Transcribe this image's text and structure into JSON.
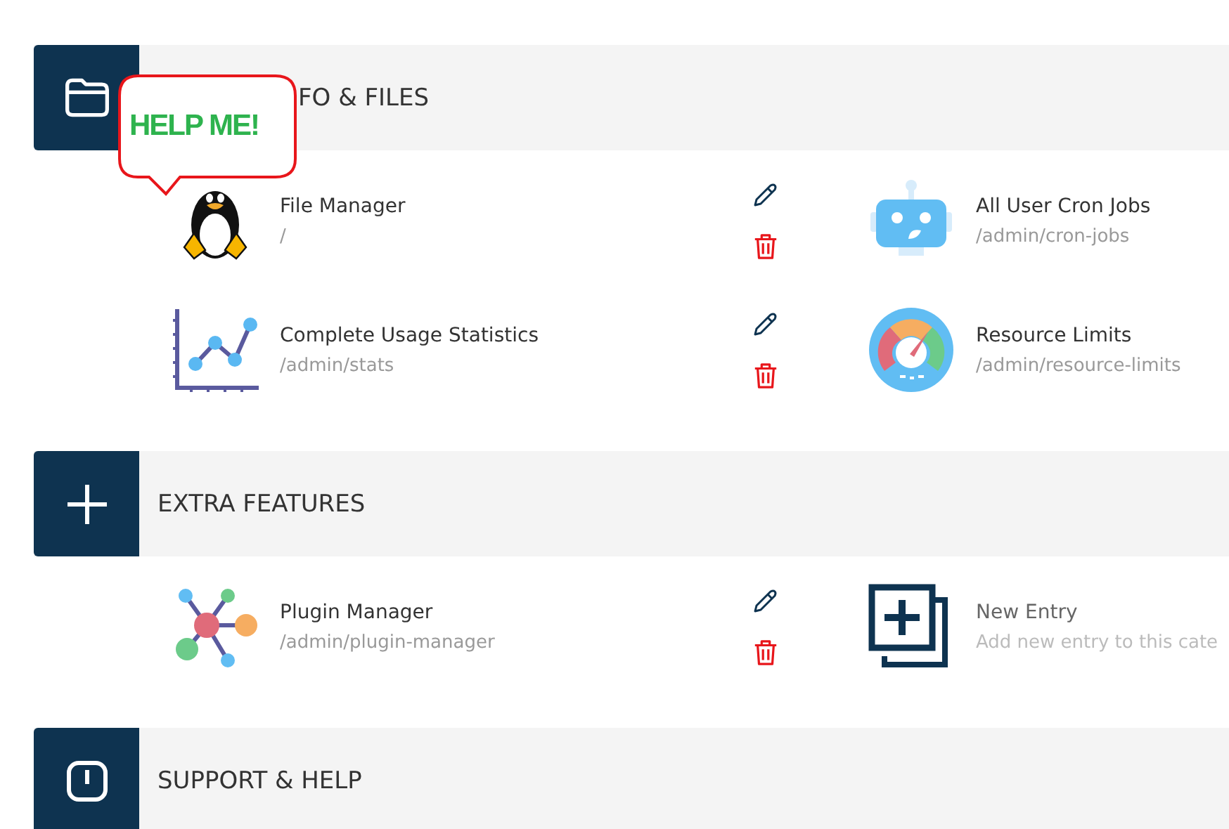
{
  "callout": {
    "text": "HELP ME!"
  },
  "sections": [
    {
      "kind": "folder",
      "title": "FO & FILES",
      "rows": [
        {
          "left": {
            "kind": "tux",
            "title": "File Manager",
            "path": "/"
          },
          "right": {
            "kind": "robot",
            "title": "All User Cron Jobs",
            "path": "/admin/cron-jobs"
          }
        },
        {
          "left": {
            "kind": "chart",
            "title": "Complete Usage Statistics",
            "path": "/admin/stats"
          },
          "right": {
            "kind": "gauge",
            "title": "Resource Limits",
            "path": "/admin/resource-limits"
          }
        }
      ]
    },
    {
      "kind": "plus",
      "title": "EXTRA FEATURES",
      "rows": [
        {
          "left": {
            "kind": "plugins",
            "title": "Plugin Manager",
            "path": "/admin/plugin-manager"
          },
          "right": {
            "kind": "new",
            "title": "New Entry",
            "path": "Add new entry to this cate"
          }
        }
      ]
    },
    {
      "kind": "support",
      "title": "SUPPORT & HELP"
    }
  ]
}
